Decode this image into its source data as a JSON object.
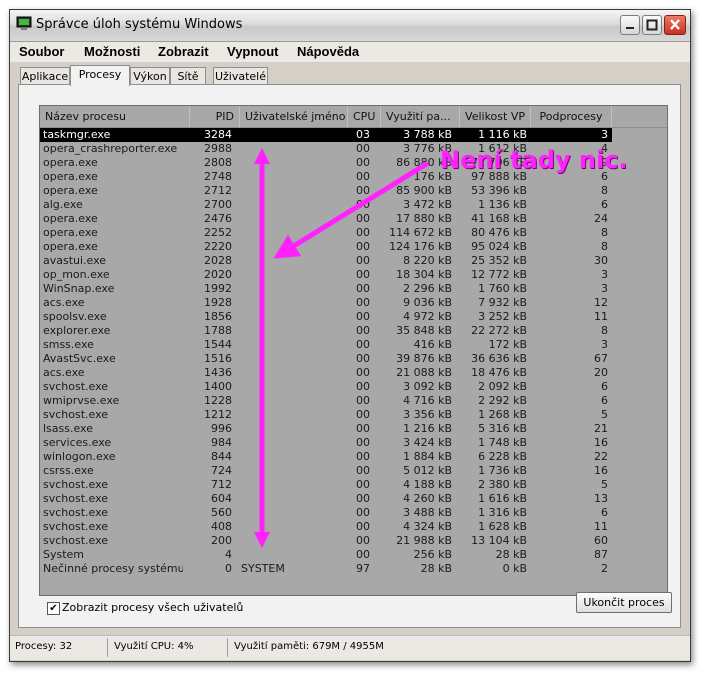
{
  "window": {
    "title": "Správce úloh systému Windows"
  },
  "menu": [
    "Soubor",
    "Možnosti",
    "Zobrazit",
    "Vypnout",
    "Nápověda"
  ],
  "tabs": [
    "Aplikace",
    "Procesy",
    "Výkon",
    "Sítě",
    "Uživatelé"
  ],
  "active_tab": "Procesy",
  "columns": {
    "name": "Název procesu",
    "pid": "PID",
    "user": "Uživatelské jméno",
    "cpu": "CPU",
    "mem": "Využití pa...",
    "vm": "Velikost VP",
    "threads": "Podprocesy"
  },
  "processes": [
    {
      "name": "taskmgr.exe",
      "pid": "3284",
      "user": "",
      "cpu": "03",
      "mem": "3 788 kB",
      "vm": "1 116 kB",
      "threads": "3"
    },
    {
      "name": "opera_crashreporter.exe",
      "pid": "2988",
      "user": "",
      "cpu": "00",
      "mem": "3 776 kB",
      "vm": "1 612 kB",
      "threads": "4"
    },
    {
      "name": "opera.exe",
      "pid": "2808",
      "user": "",
      "cpu": "00",
      "mem": "86 880 kB",
      "vm": "72 796 kB",
      "threads": "9"
    },
    {
      "name": "opera.exe",
      "pid": "2748",
      "user": "",
      "cpu": "00",
      "mem": "176 kB",
      "vm": "97 888 kB",
      "threads": "6"
    },
    {
      "name": "opera.exe",
      "pid": "2712",
      "user": "",
      "cpu": "00",
      "mem": "85 900 kB",
      "vm": "53 396 kB",
      "threads": "8"
    },
    {
      "name": "alg.exe",
      "pid": "2700",
      "user": "",
      "cpu": "00",
      "mem": "3 472 kB",
      "vm": "1 136 kB",
      "threads": "6"
    },
    {
      "name": "opera.exe",
      "pid": "2476",
      "user": "",
      "cpu": "00",
      "mem": "17 880 kB",
      "vm": "41 168 kB",
      "threads": "24"
    },
    {
      "name": "opera.exe",
      "pid": "2252",
      "user": "",
      "cpu": "00",
      "mem": "114 672 kB",
      "vm": "80 476 kB",
      "threads": "8"
    },
    {
      "name": "opera.exe",
      "pid": "2220",
      "user": "",
      "cpu": "00",
      "mem": "124 176 kB",
      "vm": "95 024 kB",
      "threads": "8"
    },
    {
      "name": "avastui.exe",
      "pid": "2028",
      "user": "",
      "cpu": "00",
      "mem": "8 220 kB",
      "vm": "25 352 kB",
      "threads": "30"
    },
    {
      "name": "op_mon.exe",
      "pid": "2020",
      "user": "",
      "cpu": "00",
      "mem": "18 304 kB",
      "vm": "12 772 kB",
      "threads": "3"
    },
    {
      "name": "WinSnap.exe",
      "pid": "1992",
      "user": "",
      "cpu": "00",
      "mem": "2 296 kB",
      "vm": "1 760 kB",
      "threads": "3"
    },
    {
      "name": "acs.exe",
      "pid": "1928",
      "user": "",
      "cpu": "00",
      "mem": "9 036 kB",
      "vm": "7 932 kB",
      "threads": "12"
    },
    {
      "name": "spoolsv.exe",
      "pid": "1856",
      "user": "",
      "cpu": "00",
      "mem": "4 972 kB",
      "vm": "3 252 kB",
      "threads": "11"
    },
    {
      "name": "explorer.exe",
      "pid": "1788",
      "user": "",
      "cpu": "00",
      "mem": "35 848 kB",
      "vm": "22 272 kB",
      "threads": "8"
    },
    {
      "name": "smss.exe",
      "pid": "1544",
      "user": "",
      "cpu": "00",
      "mem": "416 kB",
      "vm": "172 kB",
      "threads": "3"
    },
    {
      "name": "AvastSvc.exe",
      "pid": "1516",
      "user": "",
      "cpu": "00",
      "mem": "39 876 kB",
      "vm": "36 636 kB",
      "threads": "67"
    },
    {
      "name": "acs.exe",
      "pid": "1436",
      "user": "",
      "cpu": "00",
      "mem": "21 088 kB",
      "vm": "18 476 kB",
      "threads": "20"
    },
    {
      "name": "svchost.exe",
      "pid": "1400",
      "user": "",
      "cpu": "00",
      "mem": "3 092 kB",
      "vm": "2 092 kB",
      "threads": "6"
    },
    {
      "name": "wmiprvse.exe",
      "pid": "1228",
      "user": "",
      "cpu": "00",
      "mem": "4 716 kB",
      "vm": "2 292 kB",
      "threads": "6"
    },
    {
      "name": "svchost.exe",
      "pid": "1212",
      "user": "",
      "cpu": "00",
      "mem": "3 356 kB",
      "vm": "1 268 kB",
      "threads": "5"
    },
    {
      "name": "lsass.exe",
      "pid": "996",
      "user": "",
      "cpu": "00",
      "mem": "1 216 kB",
      "vm": "5 316 kB",
      "threads": "21"
    },
    {
      "name": "services.exe",
      "pid": "984",
      "user": "",
      "cpu": "00",
      "mem": "3 424 kB",
      "vm": "1 748 kB",
      "threads": "16"
    },
    {
      "name": "winlogon.exe",
      "pid": "844",
      "user": "",
      "cpu": "00",
      "mem": "1 884 kB",
      "vm": "6 228 kB",
      "threads": "22"
    },
    {
      "name": "csrss.exe",
      "pid": "724",
      "user": "",
      "cpu": "00",
      "mem": "5 012 kB",
      "vm": "1 736 kB",
      "threads": "16"
    },
    {
      "name": "svchost.exe",
      "pid": "712",
      "user": "",
      "cpu": "00",
      "mem": "4 188 kB",
      "vm": "2 380 kB",
      "threads": "5"
    },
    {
      "name": "svchost.exe",
      "pid": "604",
      "user": "",
      "cpu": "00",
      "mem": "4 260 kB",
      "vm": "1 616 kB",
      "threads": "13"
    },
    {
      "name": "svchost.exe",
      "pid": "560",
      "user": "",
      "cpu": "00",
      "mem": "3 488 kB",
      "vm": "1 316 kB",
      "threads": "6"
    },
    {
      "name": "svchost.exe",
      "pid": "408",
      "user": "",
      "cpu": "00",
      "mem": "4 324 kB",
      "vm": "1 628 kB",
      "threads": "11"
    },
    {
      "name": "svchost.exe",
      "pid": "200",
      "user": "",
      "cpu": "00",
      "mem": "21 988 kB",
      "vm": "13 104 kB",
      "threads": "60"
    },
    {
      "name": "System",
      "pid": "4",
      "user": "",
      "cpu": "00",
      "mem": "256 kB",
      "vm": "28 kB",
      "threads": "87"
    },
    {
      "name": "Nečinné procesy systému",
      "pid": "0",
      "user": "SYSTEM",
      "cpu": "97",
      "mem": "28 kB",
      "vm": "0 kB",
      "threads": "2"
    }
  ],
  "show_all_users": {
    "label": "Zobrazit procesy všech uživatelů",
    "checked": true,
    "check_glyph": "✔"
  },
  "end_process_button": "Ukončit proces",
  "status": {
    "processes": "Procesy: 32",
    "cpu": "Využití CPU: 4%",
    "memory": "Využití paměti: 679M / 4955M"
  },
  "annotation": {
    "text": "Není tady nic.",
    "color": "#ff22ff"
  }
}
